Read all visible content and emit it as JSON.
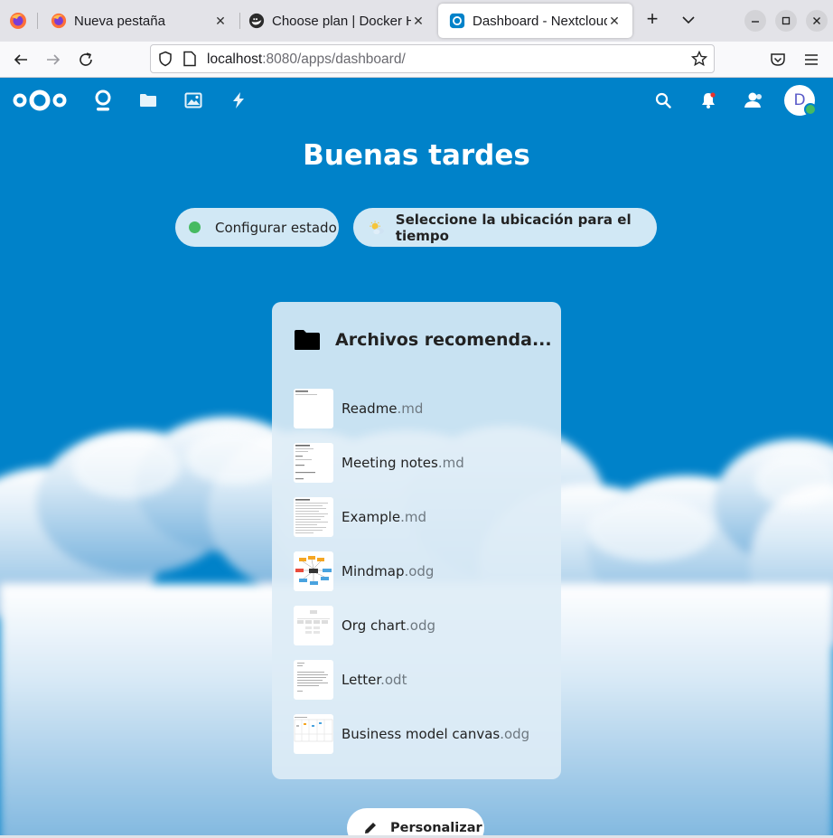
{
  "browser": {
    "tabs": [
      {
        "title": "Nueva pestaña",
        "icon": "firefox-icon"
      },
      {
        "title": "Choose plan | Docker Hub",
        "icon": "docker-icon"
      },
      {
        "title": "Dashboard - Nextcloud",
        "icon": "nextcloud-icon",
        "active": true
      }
    ],
    "url_host": "localhost",
    "url_rest": ":8080/apps/dashboard/"
  },
  "nextcloud": {
    "header_apps": [
      "dashboard-icon",
      "files-icon",
      "photos-icon",
      "activity-icon"
    ],
    "header_right": [
      "search-icon",
      "notifications-icon",
      "contacts-icon"
    ],
    "avatar_letter": "D",
    "greeting": "Buenas tardes",
    "status_label": "Configurar estado",
    "weather_label": "Seleccione la ubicación para el tiempo",
    "widget_title": "Archivos recomenda...",
    "files": [
      {
        "name": "Readme",
        "ext": ".md",
        "thumb": "doc"
      },
      {
        "name": "Meeting notes",
        "ext": ".md",
        "thumb": "doc"
      },
      {
        "name": "Example",
        "ext": ".md",
        "thumb": "doc"
      },
      {
        "name": "Mindmap",
        "ext": ".odg",
        "thumb": "mindmap"
      },
      {
        "name": "Org chart",
        "ext": ".odg",
        "thumb": "orgchart"
      },
      {
        "name": "Letter",
        "ext": ".odt",
        "thumb": "letter"
      },
      {
        "name": "Business model canvas",
        "ext": ".odg",
        "thumb": "canvas"
      }
    ],
    "customize_label": "Personalizar",
    "colors": {
      "brand": "#0082c9",
      "online": "#46ba61"
    }
  }
}
